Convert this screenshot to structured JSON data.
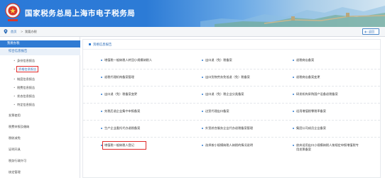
{
  "header": {
    "title": "国家税务总局上海市电子税务局"
  },
  "breadcrumb": {
    "home": "首页",
    "separator": ">",
    "current": "我要办税",
    "back_label": "返回"
  },
  "sidebar": {
    "head": "我要办税",
    "sub": "综合信息报告",
    "children": [
      {
        "label": "身份信息报告",
        "active": false
      },
      {
        "label": "资格信息报告",
        "active": true
      },
      {
        "label": "制度信息报告",
        "active": false
      },
      {
        "label": "税费信息报告",
        "active": false
      },
      {
        "label": "状态信息报告",
        "active": false
      },
      {
        "label": "特定信息报告",
        "active": false
      }
    ],
    "top_items": [
      "发票使用",
      "税费申报及缴纳",
      "税收减免",
      "证明开具",
      "税务行政许可",
      "核定管理"
    ]
  },
  "main": {
    "section_title": "资格信息报告",
    "rows": [
      [
        "增值税一般纳税人转回小规模纳税人",
        "出口退（免）税备案",
        "退税商店备案"
      ],
      [
        "退税代理机构备案管理",
        "出口货物劳务免抵退（免）税备案",
        "退税商店备案变更"
      ],
      [
        "出口退（免）税备案变更",
        "出口退（免）税企业分类备案",
        "研发机构采购国产设备退税备案"
      ],
      [
        "先税后退企业集中申报备案",
        "边贸代理出口备案",
        "适用增值税零税率备案"
      ],
      [
        "生产企业委托代办退税备案",
        "外贸综合服务企业代办退税备案管理",
        "集团公司成员企业备案"
      ],
      [
        "增值税一般纳税人登记",
        "选择按小规模纳税人纳税的情况说明",
        "放弃适用出口小规模纳税人按规定申报增值税专用发票备案"
      ]
    ],
    "highlighted_cell": "增值税一般纳税人登记"
  }
}
